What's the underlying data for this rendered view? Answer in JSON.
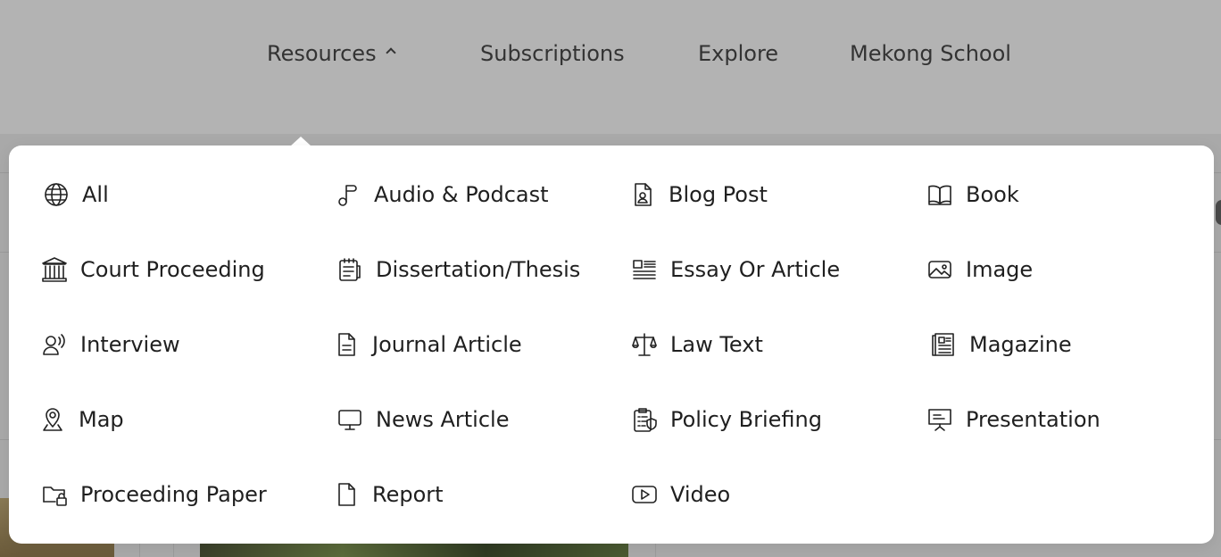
{
  "nav": {
    "items": [
      "Resources",
      "Subscriptions",
      "Explore",
      "Mekong School"
    ],
    "active": "Resources"
  },
  "resources_menu": {
    "items": [
      {
        "label": "All",
        "icon": "globe-icon"
      },
      {
        "label": "Audio & Podcast",
        "icon": "music-note-icon"
      },
      {
        "label": "Blog Post",
        "icon": "blog-post-icon"
      },
      {
        "label": "Book",
        "icon": "book-icon"
      },
      {
        "label": "Court Proceeding",
        "icon": "courthouse-icon"
      },
      {
        "label": "Dissertation/Thesis",
        "icon": "thesis-icon"
      },
      {
        "label": "Essay Or Article",
        "icon": "essay-icon"
      },
      {
        "label": "Image",
        "icon": "image-icon"
      },
      {
        "label": "Interview",
        "icon": "interview-icon"
      },
      {
        "label": "Journal Article",
        "icon": "document-icon"
      },
      {
        "label": "Law Text",
        "icon": "scales-icon"
      },
      {
        "label": "Magazine",
        "icon": "magazine-icon"
      },
      {
        "label": "Map",
        "icon": "map-pin-icon"
      },
      {
        "label": "News Article",
        "icon": "monitor-icon"
      },
      {
        "label": "Policy Briefing",
        "icon": "clipboard-icon"
      },
      {
        "label": "Presentation",
        "icon": "presentation-icon"
      },
      {
        "label": "Proceeding Paper",
        "icon": "folder-lock-icon"
      },
      {
        "label": "Report",
        "icon": "file-icon"
      },
      {
        "label": "Video",
        "icon": "video-icon"
      }
    ]
  }
}
